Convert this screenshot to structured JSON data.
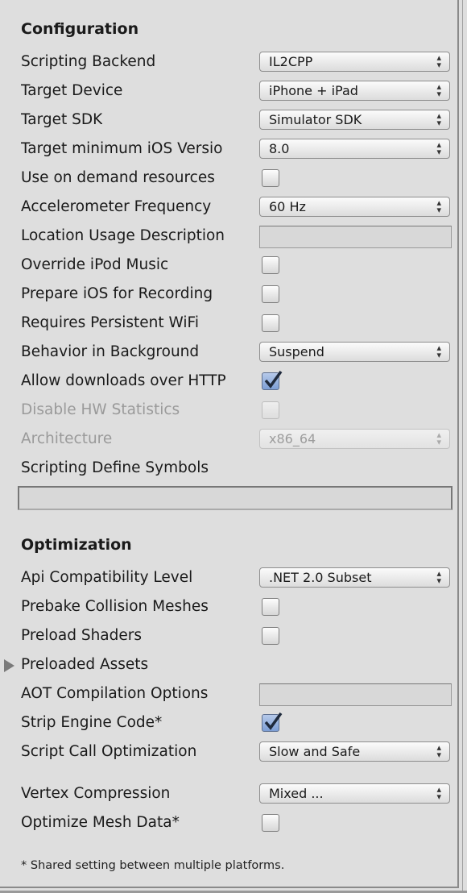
{
  "configuration": {
    "title": "Configuration",
    "scripting_backend": {
      "label": "Scripting Backend",
      "value": "IL2CPP"
    },
    "target_device": {
      "label": "Target Device",
      "value": "iPhone + iPad"
    },
    "target_sdk": {
      "label": "Target SDK",
      "value": "Simulator SDK"
    },
    "target_min_ios": {
      "label": "Target minimum iOS Versio",
      "value": "8.0"
    },
    "on_demand": {
      "label": "Use on demand resources",
      "checked": false
    },
    "accelerometer": {
      "label": "Accelerometer Frequency",
      "value": "60 Hz"
    },
    "location_usage": {
      "label": "Location Usage Description",
      "value": ""
    },
    "override_ipod": {
      "label": "Override iPod Music",
      "checked": false
    },
    "prepare_recording": {
      "label": "Prepare iOS for Recording",
      "checked": false
    },
    "persistent_wifi": {
      "label": "Requires Persistent WiFi",
      "checked": false
    },
    "behavior_background": {
      "label": "Behavior in Background",
      "value": "Suspend"
    },
    "allow_http": {
      "label": "Allow downloads over HTTP",
      "checked": true
    },
    "disable_hw_stats": {
      "label": "Disable HW Statistics",
      "checked": false,
      "disabled": true
    },
    "architecture": {
      "label": "Architecture",
      "value": "x86_64",
      "disabled": true
    },
    "define_symbols": {
      "label": "Scripting Define Symbols",
      "value": ""
    }
  },
  "optimization": {
    "title": "Optimization",
    "api_level": {
      "label": "Api Compatibility Level",
      "value": ".NET 2.0 Subset"
    },
    "prebake": {
      "label": "Prebake Collision Meshes",
      "checked": false
    },
    "preload_shaders": {
      "label": "Preload Shaders",
      "checked": false
    },
    "preloaded_assets": {
      "label": "Preloaded Assets",
      "expanded": false
    },
    "aot": {
      "label": "AOT Compilation Options",
      "value": ""
    },
    "strip_engine": {
      "label": "Strip Engine Code*",
      "checked": true
    },
    "script_call": {
      "label": "Script Call Optimization",
      "value": "Slow and Safe"
    },
    "vertex_compression": {
      "label": "Vertex Compression",
      "value": "Mixed ..."
    },
    "optimize_mesh": {
      "label": "Optimize Mesh Data*",
      "checked": false
    }
  },
  "footnote": "* Shared setting between multiple platforms.",
  "colors": {
    "background": "#dedede",
    "checkbox_checked": "#7d9fd6"
  }
}
